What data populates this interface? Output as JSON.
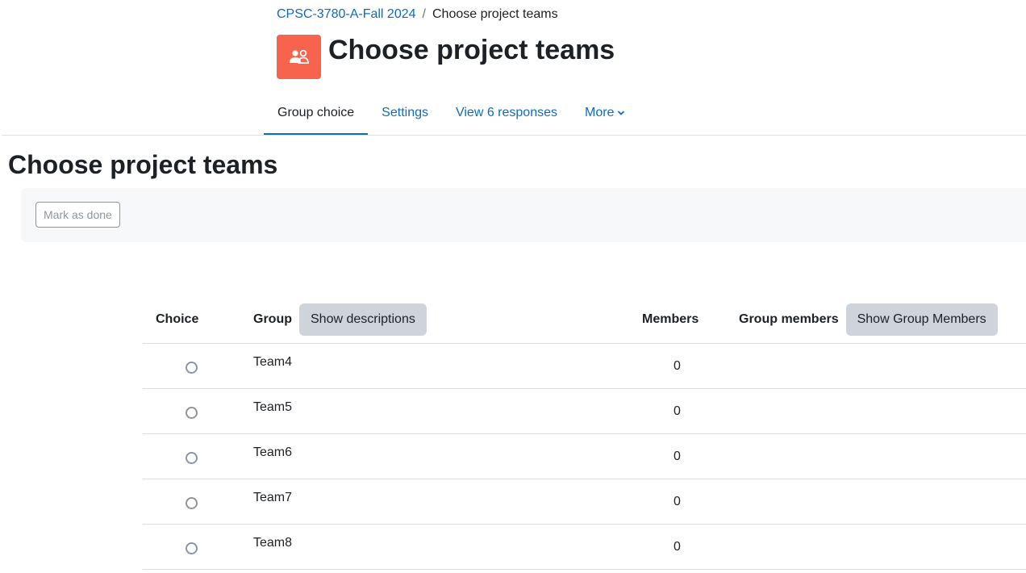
{
  "breadcrumb": {
    "course": "CPSC-3780-A-Fall 2024",
    "separator": "/",
    "current": "Choose project teams"
  },
  "header": {
    "icon": "group-choice-icon",
    "title": "Choose project teams",
    "accent_color": "#f7634d"
  },
  "nav": {
    "tabs": [
      {
        "label": "Group choice",
        "active": true
      },
      {
        "label": "Settings"
      },
      {
        "label": "View 6 responses"
      },
      {
        "label": "More"
      }
    ]
  },
  "main": {
    "title": "Choose project teams",
    "mark_done_label": "Mark as done"
  },
  "table": {
    "headers": {
      "choice": "Choice",
      "group": "Group",
      "show_descriptions": "Show descriptions",
      "members": "Members",
      "group_members": "Group members",
      "show_group_members": "Show Group Members"
    },
    "rows": [
      {
        "name": "Team4",
        "members": "0"
      },
      {
        "name": "Team5",
        "members": "0"
      },
      {
        "name": "Team6",
        "members": "0"
      },
      {
        "name": "Team7",
        "members": "0"
      },
      {
        "name": "Team8",
        "members": "0"
      }
    ]
  }
}
